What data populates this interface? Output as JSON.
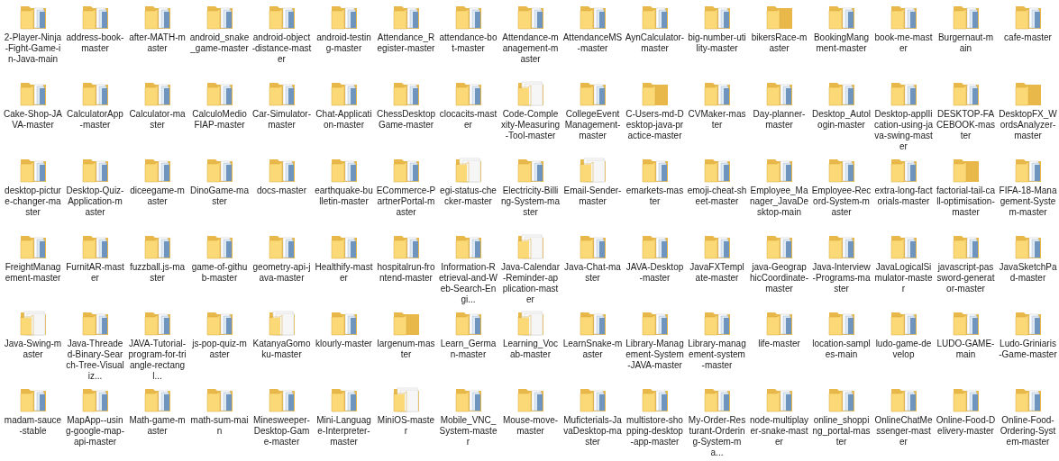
{
  "folders": [
    {
      "name": "2-Player-Ninja-Fight-Game-in-Java-main",
      "kind": "files"
    },
    {
      "name": "address-book-master",
      "kind": "files"
    },
    {
      "name": "after-MATH-master",
      "kind": "files"
    },
    {
      "name": "android_snake_game-master",
      "kind": "files"
    },
    {
      "name": "android-object-distance-master",
      "kind": "files"
    },
    {
      "name": "android-testing-master",
      "kind": "files"
    },
    {
      "name": "Attendance_Register-master",
      "kind": "files"
    },
    {
      "name": "attendance-bot-master",
      "kind": "files"
    },
    {
      "name": "Attendance-management-master",
      "kind": "files"
    },
    {
      "name": "AttendanceMS-master",
      "kind": "files"
    },
    {
      "name": "AynCalculator-master",
      "kind": "files"
    },
    {
      "name": "big-number-utility-master",
      "kind": "files"
    },
    {
      "name": "bikersRace-master",
      "kind": "empty"
    },
    {
      "name": "BookingMangment-master",
      "kind": "files"
    },
    {
      "name": "book-me-master",
      "kind": "files"
    },
    {
      "name": "Burgernaut-main",
      "kind": "files"
    },
    {
      "name": "cafe-master",
      "kind": "files"
    },
    {
      "name": "Cake-Shop-JAVA-master",
      "kind": "files"
    },
    {
      "name": "CalculatorApp-master",
      "kind": "files"
    },
    {
      "name": "Calculator-master",
      "kind": "files"
    },
    {
      "name": "CalculoMedioFIAP-master",
      "kind": "files"
    },
    {
      "name": "Car-Simulator-master",
      "kind": "files"
    },
    {
      "name": "Chat-Application-master",
      "kind": "files"
    },
    {
      "name": "ChessDesktopGame-master",
      "kind": "files"
    },
    {
      "name": "clocacits-master",
      "kind": "files"
    },
    {
      "name": "Code-Complexity-Measuring-Tool-master",
      "kind": "white"
    },
    {
      "name": "CollegeEventManagement-master",
      "kind": "files"
    },
    {
      "name": "C-Users-md-Desktop-java-practice-master",
      "kind": "empty"
    },
    {
      "name": "CVMaker-master",
      "kind": "files"
    },
    {
      "name": "Day-planner-master",
      "kind": "files"
    },
    {
      "name": "Desktop_Autologin-master",
      "kind": "files"
    },
    {
      "name": "Desktop-applIication-using-java-swing-master",
      "kind": "files"
    },
    {
      "name": "DESKTOP-FACEBOOK-master",
      "kind": "files"
    },
    {
      "name": "DesktopFX_WordsAnalyzer-master",
      "kind": "empty"
    },
    {
      "name": "desktop-picture-changer-master",
      "kind": "files"
    },
    {
      "name": "Desktop-Quiz-Application-master",
      "kind": "files"
    },
    {
      "name": "diceegame-master",
      "kind": "files"
    },
    {
      "name": "DinoGame-master",
      "kind": "files"
    },
    {
      "name": "docs-master",
      "kind": "files"
    },
    {
      "name": "earthquake-bulletin-master",
      "kind": "files"
    },
    {
      "name": "ECommerce-PartnerPortal-master",
      "kind": "files"
    },
    {
      "name": "egi-status-checker-master",
      "kind": "white"
    },
    {
      "name": "Electricity-Billing-System-master",
      "kind": "files"
    },
    {
      "name": "Email-Sender-master",
      "kind": "white"
    },
    {
      "name": "emarkets-master",
      "kind": "files"
    },
    {
      "name": "emoji-cheat-sheet-master",
      "kind": "files"
    },
    {
      "name": "Employee_Manager_JavaDesktop-main",
      "kind": "files"
    },
    {
      "name": "Employee-Record-System-master",
      "kind": "files"
    },
    {
      "name": "extra-long-factorials-master",
      "kind": "files"
    },
    {
      "name": "factorial-tail-call-optimisation-master",
      "kind": "empty"
    },
    {
      "name": "FIFA-18-Management-System-master",
      "kind": "files"
    },
    {
      "name": "FreightManagement-master",
      "kind": "files"
    },
    {
      "name": "FurnitAR-master",
      "kind": "files"
    },
    {
      "name": "fuzzball.js-master",
      "kind": "files"
    },
    {
      "name": "game-of-github-master",
      "kind": "files"
    },
    {
      "name": "geometry-api-java-master",
      "kind": "files"
    },
    {
      "name": "Healthify-master",
      "kind": "files"
    },
    {
      "name": "hospitalrun-frontend-master",
      "kind": "files"
    },
    {
      "name": "Information-Retrieval-and-Web-Search-Engi...",
      "kind": "files"
    },
    {
      "name": "Java-Calendar-Reminder-application-master",
      "kind": "white"
    },
    {
      "name": "Java-Chat-master",
      "kind": "files"
    },
    {
      "name": "JAVA-Desktop-master",
      "kind": "files"
    },
    {
      "name": "JavaFXTemplate-master",
      "kind": "files"
    },
    {
      "name": "java-GeographicCoordinate-master",
      "kind": "files"
    },
    {
      "name": "Java-Interview-Programs-master",
      "kind": "files"
    },
    {
      "name": "JavaLogicalSimulator-master",
      "kind": "files"
    },
    {
      "name": "javascript-password-generator-master",
      "kind": "files"
    },
    {
      "name": "JavaSketchPad-master",
      "kind": "files"
    },
    {
      "name": "Java-Swing-master",
      "kind": "white"
    },
    {
      "name": "Java-Threaded-Binary-Search-Tree-Visualiz...",
      "kind": "files"
    },
    {
      "name": "JAVA-Tutorial-program-for-triangle-rectangl...",
      "kind": "files"
    },
    {
      "name": "js-pop-quiz-master",
      "kind": "files"
    },
    {
      "name": "KatanyaGomoku-master",
      "kind": "white"
    },
    {
      "name": "klourly-master",
      "kind": "files"
    },
    {
      "name": "largenum-master",
      "kind": "empty"
    },
    {
      "name": "Learn_German-master",
      "kind": "files"
    },
    {
      "name": "Learning_Vocab-master",
      "kind": "white"
    },
    {
      "name": "LearnSnake-master",
      "kind": "files"
    },
    {
      "name": "Library-Management-System-JAVA-master",
      "kind": "files"
    },
    {
      "name": "Library-management-system-master",
      "kind": "files"
    },
    {
      "name": "life-master",
      "kind": "files"
    },
    {
      "name": "location-samples-main",
      "kind": "files"
    },
    {
      "name": "ludo-game-develop",
      "kind": "files"
    },
    {
      "name": "LUDO-GAME-main",
      "kind": "files"
    },
    {
      "name": "Ludo-Griniaris-Game-master",
      "kind": "files"
    },
    {
      "name": "madam-sauce-stable",
      "kind": "files"
    },
    {
      "name": "MapApp--using-google-map-api-master",
      "kind": "files"
    },
    {
      "name": "Math-game-master",
      "kind": "files"
    },
    {
      "name": "math-sum-main",
      "kind": "files"
    },
    {
      "name": "Minesweeper-Desktop-Game-master",
      "kind": "files"
    },
    {
      "name": "Mini-Language-Interpreter-master",
      "kind": "files"
    },
    {
      "name": "MiniOS-master",
      "kind": "white"
    },
    {
      "name": "Mobile_VNC_System-master",
      "kind": "files"
    },
    {
      "name": "Mouse-move-master",
      "kind": "files"
    },
    {
      "name": "Muficterials-JavaDesktop-master",
      "kind": "files"
    },
    {
      "name": "multistore-shopping-desktop-app-master",
      "kind": "files"
    },
    {
      "name": "My-Order-Resturant-Ordering-System-ma...",
      "kind": "files"
    },
    {
      "name": "node-multiplayer-snake-master",
      "kind": "files"
    },
    {
      "name": "online_shopping_portal-master",
      "kind": "files"
    },
    {
      "name": "OnlineChatMessenger-master",
      "kind": "files"
    },
    {
      "name": "Online-Food-Delivery-master",
      "kind": "files"
    },
    {
      "name": "Online-Food-Ordering-System-master",
      "kind": "files"
    }
  ]
}
